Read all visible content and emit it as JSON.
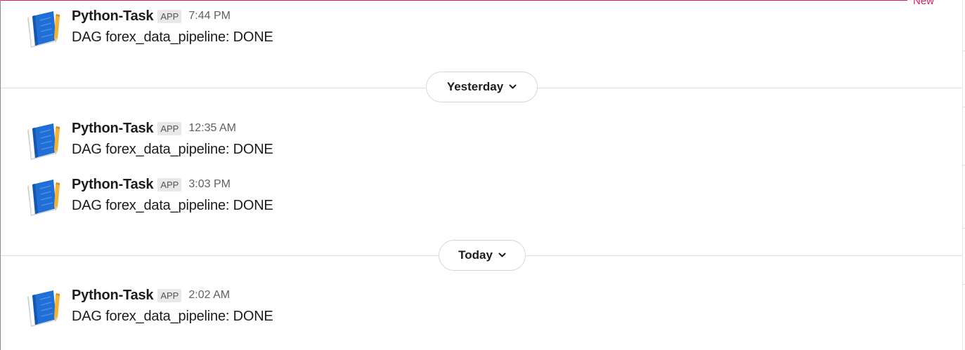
{
  "banner": {
    "new_label": "New"
  },
  "days": [
    {
      "label": "Yesterday",
      "icon": "chevron-down-icon"
    },
    {
      "label": "Today",
      "icon": "chevron-down-icon"
    }
  ],
  "messages": [
    {
      "sender": "Python-Task",
      "badge": "APP",
      "time": "7:44 PM",
      "text": "DAG forex_data_pipeline: DONE",
      "avatar_icon": "notebook-pencil-icon"
    },
    {
      "sender": "Python-Task",
      "badge": "APP",
      "time": "12:35 AM",
      "text": "DAG forex_data_pipeline: DONE",
      "avatar_icon": "notebook-pencil-icon"
    },
    {
      "sender": "Python-Task",
      "badge": "APP",
      "time": "3:03 PM",
      "text": "DAG forex_data_pipeline: DONE",
      "avatar_icon": "notebook-pencil-icon"
    },
    {
      "sender": "Python-Task",
      "badge": "APP",
      "time": "2:02 AM",
      "text": "DAG forex_data_pipeline: DONE",
      "avatar_icon": "notebook-pencil-icon"
    }
  ],
  "colors": {
    "new_marker": "#e01e5a",
    "avatar_blue": "#1f6fd6",
    "avatar_pencil": "#f2b230"
  }
}
